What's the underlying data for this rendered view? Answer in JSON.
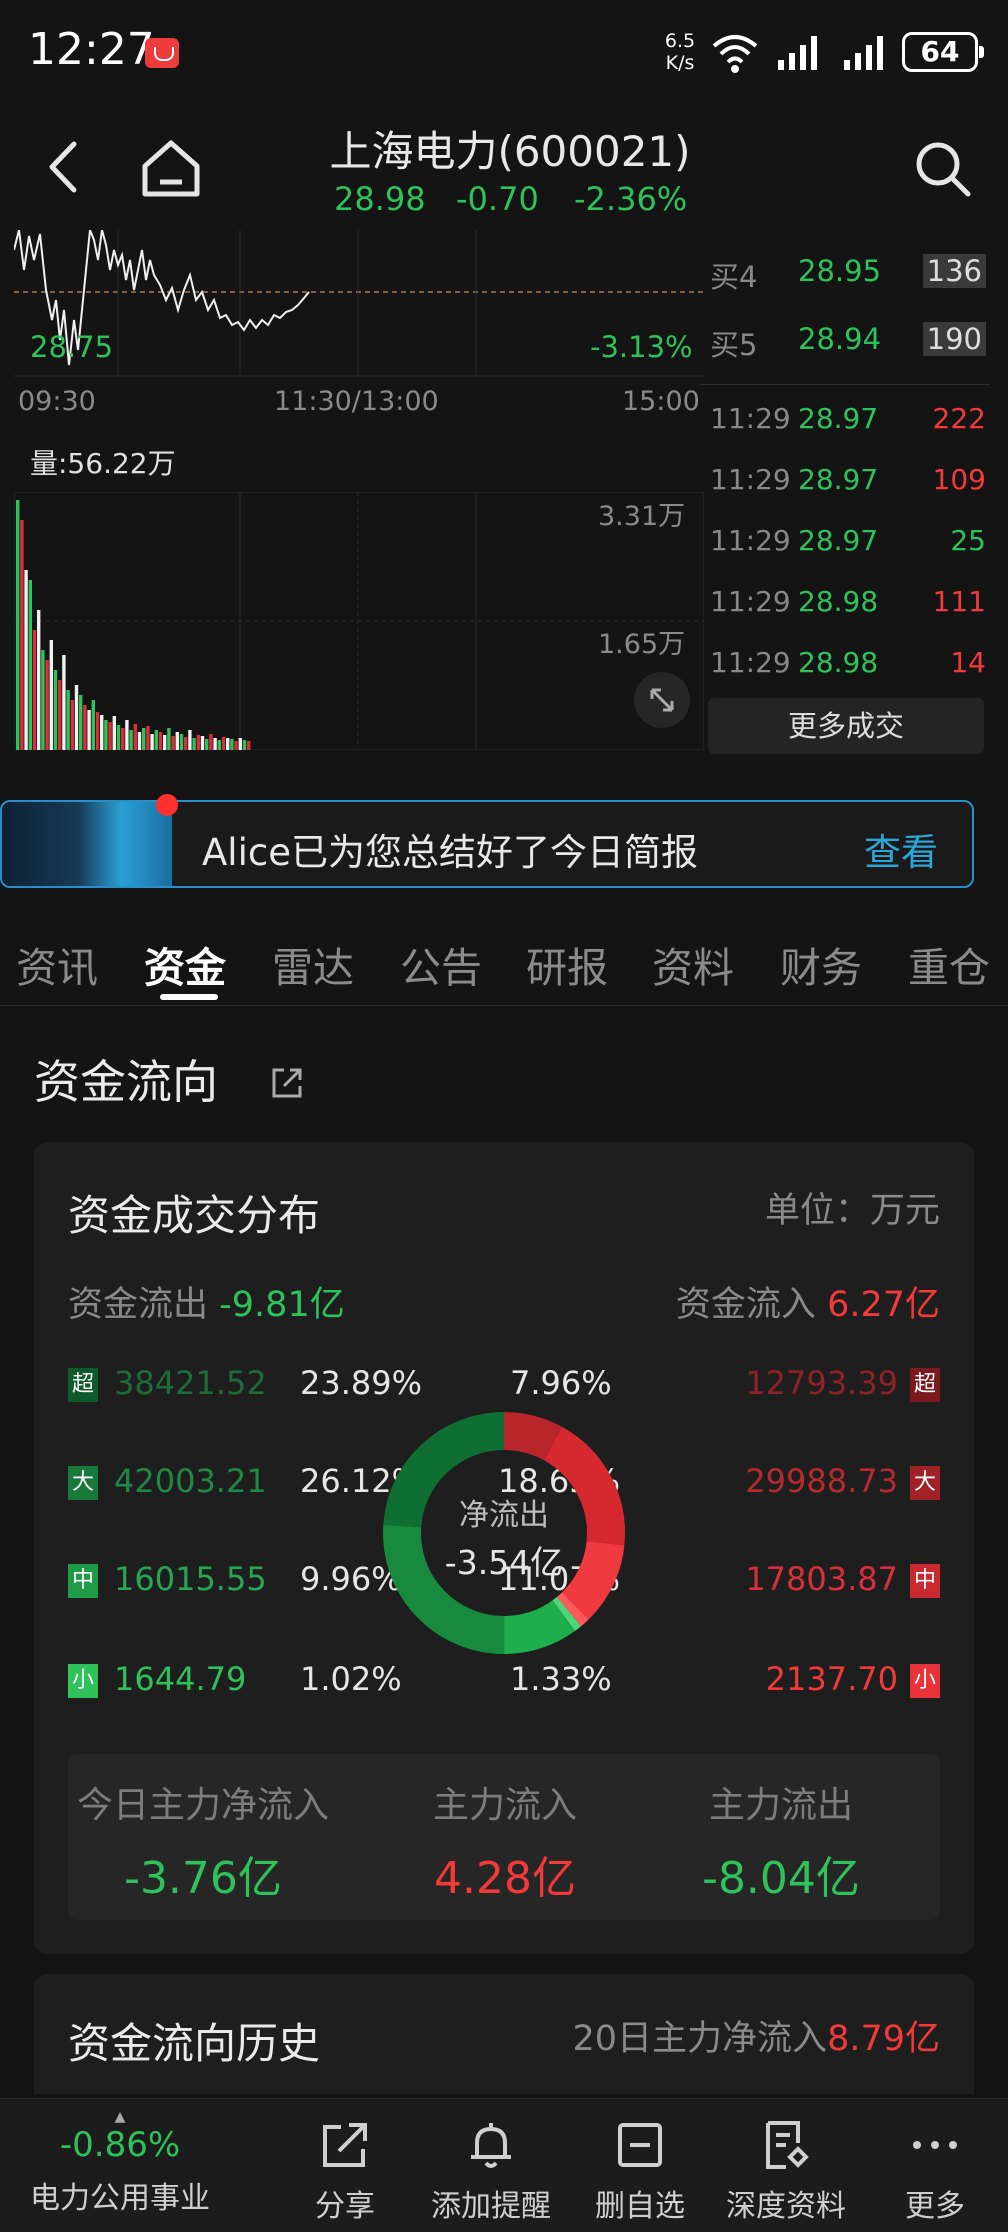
{
  "status_bar": {
    "time": "12:27",
    "net_speed_value": "6.5",
    "net_speed_unit": "K/s",
    "battery": "64"
  },
  "header": {
    "stock_name": "上海电力(600021)",
    "price": "28.98",
    "change": "-0.70",
    "change_pct": "-2.36%"
  },
  "chart": {
    "low_price": "28.75",
    "low_pct": "-3.13%",
    "time_start": "09:30",
    "time_mid": "11:30/13:00",
    "time_end": "15:00",
    "volume_label": "量:56.22万",
    "volume_tick_top": "3.31万",
    "volume_tick_mid": "1.65万"
  },
  "order_book": [
    {
      "label": "买4",
      "price": "28.95",
      "volume": "136"
    },
    {
      "label": "买5",
      "price": "28.94",
      "volume": "190"
    }
  ],
  "trades": [
    {
      "time": "11:29",
      "price": "28.97",
      "volume": "222",
      "side": "buy"
    },
    {
      "time": "11:29",
      "price": "28.97",
      "volume": "109",
      "side": "buy"
    },
    {
      "time": "11:29",
      "price": "28.97",
      "volume": "25",
      "side": "sell"
    },
    {
      "time": "11:29",
      "price": "28.98",
      "volume": "111",
      "side": "buy"
    },
    {
      "time": "11:29",
      "price": "28.98",
      "volume": "14",
      "side": "buy"
    }
  ],
  "more_trades_label": "更多成交",
  "banner": {
    "text": "Alice已为您总结好了今日简报",
    "view_label": "查看"
  },
  "tabs": [
    "资讯",
    "资金",
    "雷达",
    "公告",
    "研报",
    "资料",
    "财务",
    "重仓"
  ],
  "active_tab": "资金",
  "section_title": "资金流向",
  "distribution": {
    "title": "资金成交分布",
    "unit": "单位：万元",
    "outflow_label": "资金流出",
    "outflow_value": "-9.81亿",
    "inflow_label": "资金流入",
    "inflow_value": "6.27亿",
    "outflow_rows": [
      {
        "badge": "超",
        "amount": "38421.52",
        "pct": "23.89%"
      },
      {
        "badge": "大",
        "amount": "42003.21",
        "pct": "26.12%"
      },
      {
        "badge": "中",
        "amount": "16015.55",
        "pct": "9.96%"
      },
      {
        "badge": "小",
        "amount": "1644.79",
        "pct": "1.02%"
      }
    ],
    "inflow_rows": [
      {
        "badge": "超",
        "amount": "12793.39",
        "pct": "7.96%"
      },
      {
        "badge": "大",
        "amount": "29988.73",
        "pct": "18.65%"
      },
      {
        "badge": "中",
        "amount": "17803.87",
        "pct": "11.07%"
      },
      {
        "badge": "小",
        "amount": "2137.70",
        "pct": "1.33%"
      }
    ],
    "net_label": "净流出",
    "net_value": "-3.54亿",
    "summary": {
      "net_main_label": "今日主力净流入",
      "net_main_value": "-3.76亿",
      "main_in_label": "主力流入",
      "main_in_value": "4.28亿",
      "main_out_label": "主力流出",
      "main_out_value": "-8.04亿"
    }
  },
  "history": {
    "title": "资金流向历史",
    "label": "20日主力净流入",
    "value": "8.79亿"
  },
  "bottom_nav": {
    "sector_change": "-0.86%",
    "sector_name": "电力公用事业",
    "items": [
      "分享",
      "添加提醒",
      "删自选",
      "深度资料",
      "更多"
    ]
  },
  "colors": {
    "up_red": "#f23a3a",
    "down_green": "#2fc25b",
    "accent_blue": "#2aa7d8"
  }
}
